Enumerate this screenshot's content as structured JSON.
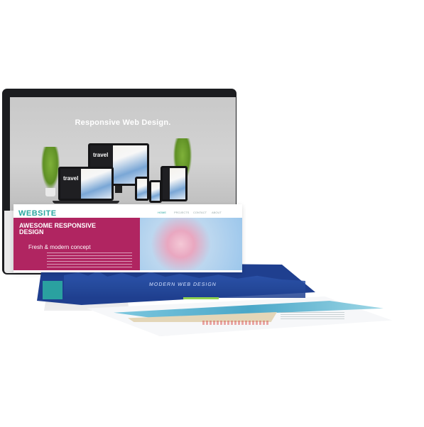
{
  "screen": {
    "title": "Responsive Web Design."
  },
  "devices": {
    "travel_text": "travel"
  },
  "page1": {
    "logo": "WEBSITE",
    "nav": [
      "HOME",
      "PROJECTS",
      "CONTACT",
      "ABOUT"
    ],
    "headline": "AWESOME RESPONSIVE DESIGN",
    "subheadline": "Fresh & modern concept"
  },
  "page2": {
    "title": "MODERN WEB DESIGN"
  },
  "colors": {
    "hero": "#b02561",
    "accent": "#2aa7a0",
    "page2": "#1f3f8f"
  }
}
